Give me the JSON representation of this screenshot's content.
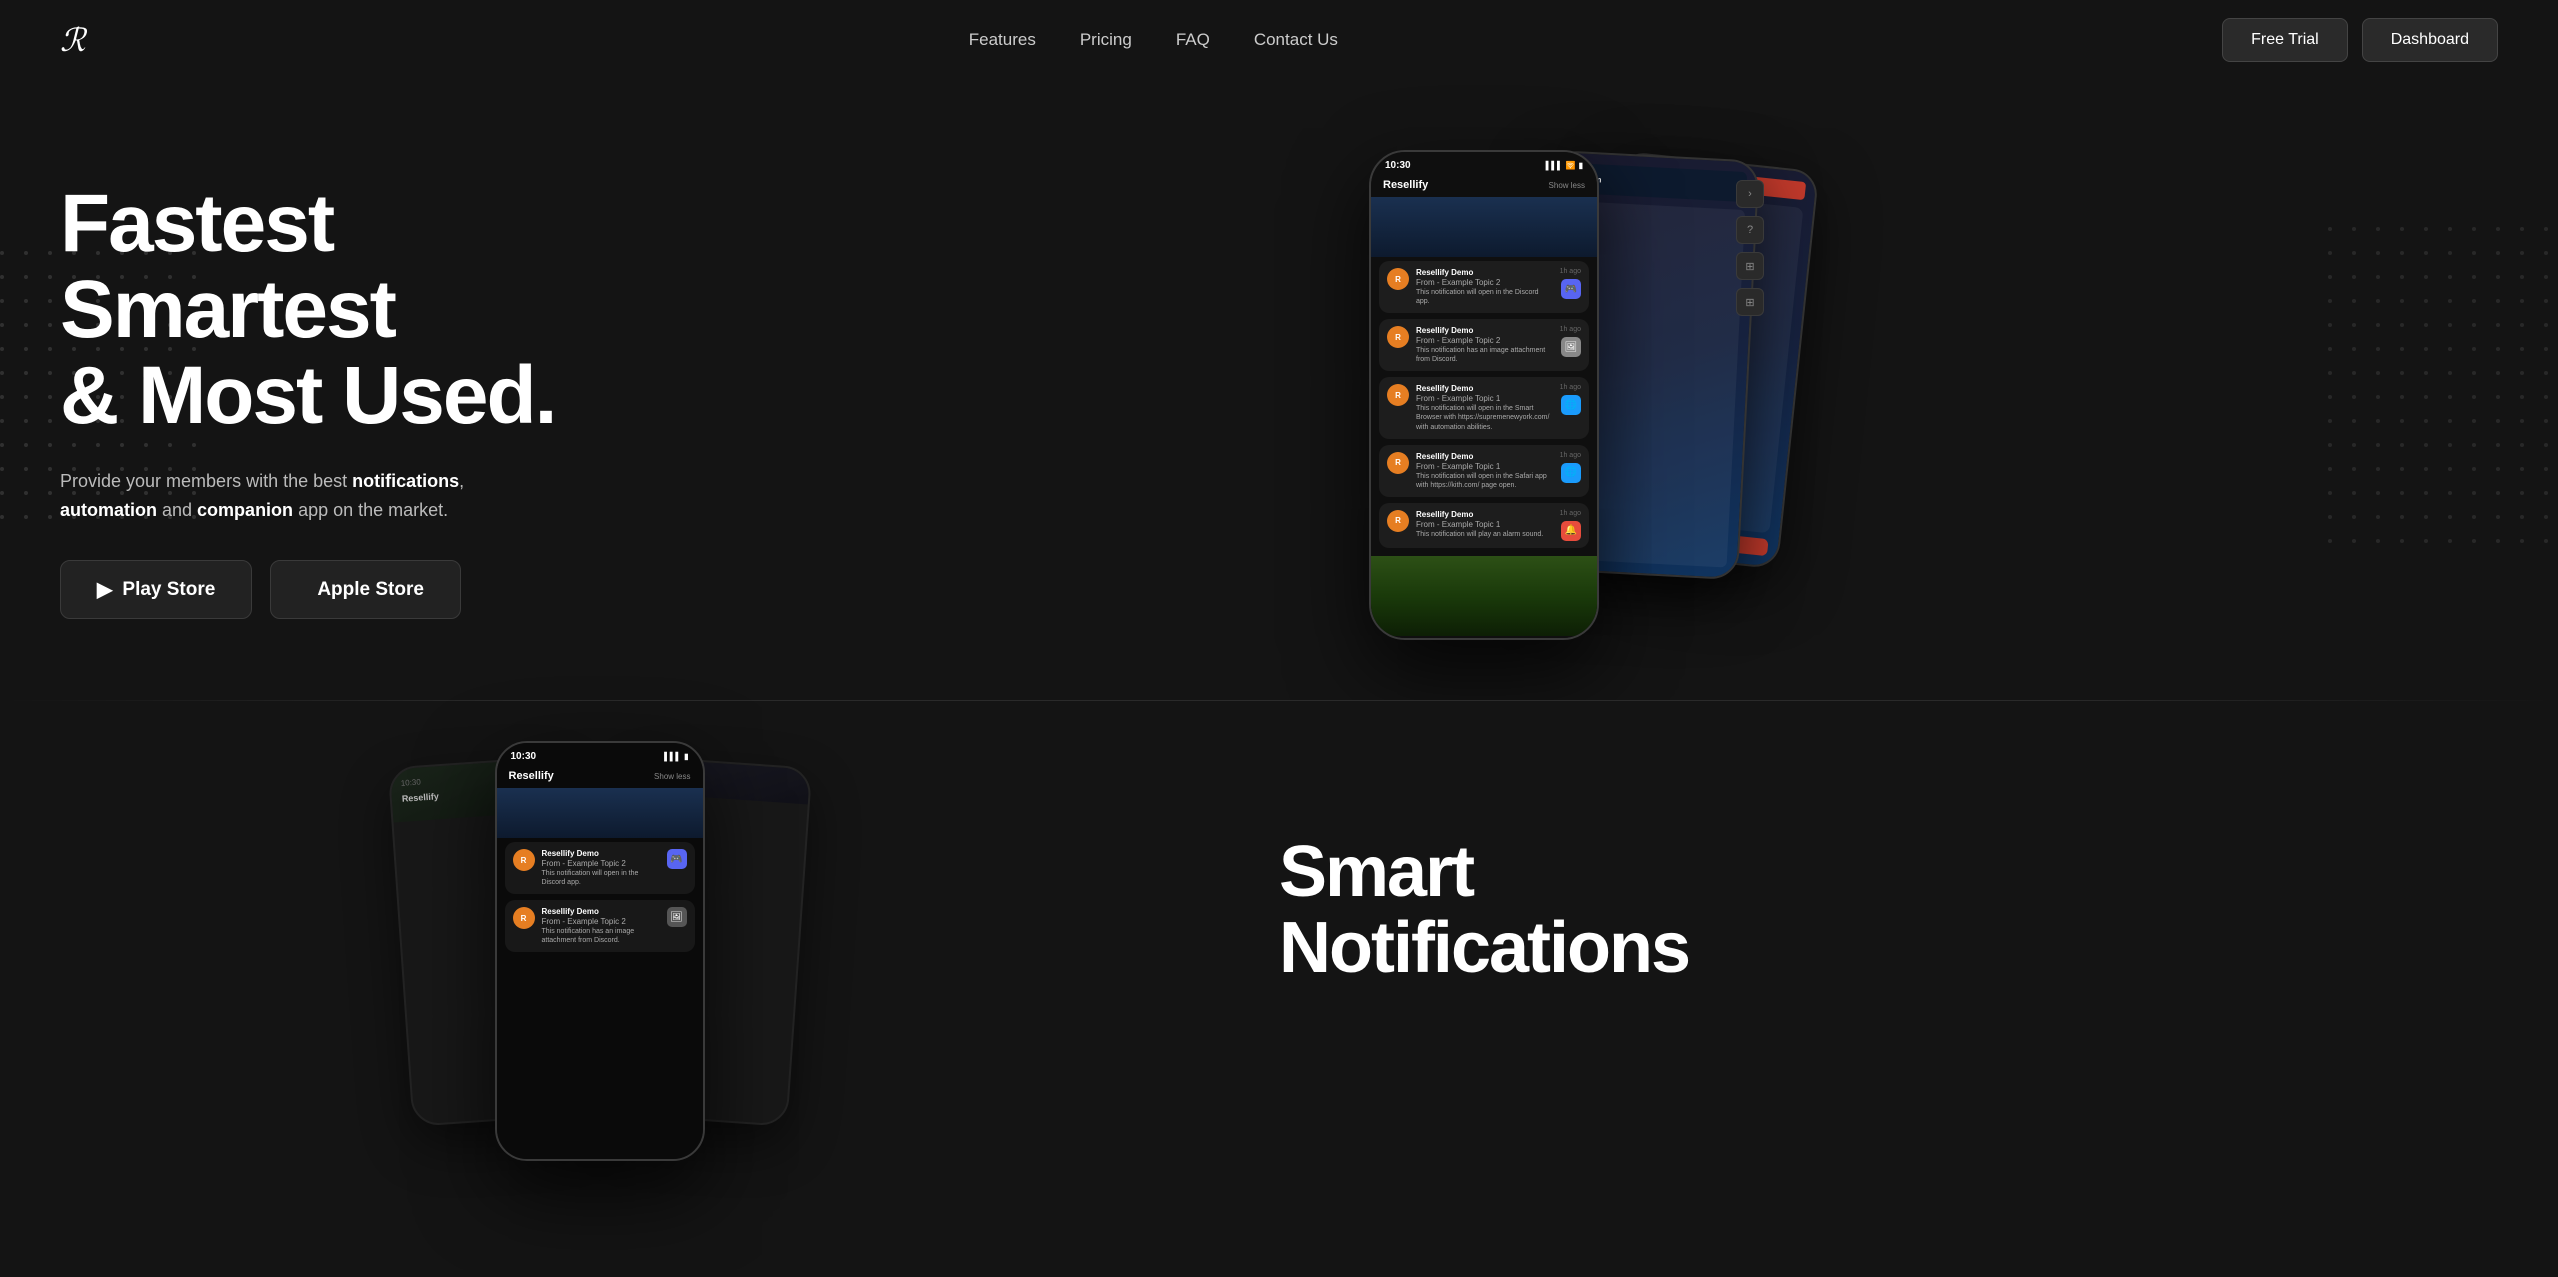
{
  "brand": {
    "logo": "ℛ",
    "name": "Resellify"
  },
  "nav": {
    "links": [
      {
        "id": "features",
        "label": "Features"
      },
      {
        "id": "pricing",
        "label": "Pricing"
      },
      {
        "id": "faq",
        "label": "FAQ"
      },
      {
        "id": "contact",
        "label": "Contact Us"
      }
    ],
    "cta_trial": "Free Trial",
    "cta_dashboard": "Dashboard"
  },
  "hero": {
    "title_line1": "Fastest",
    "title_line2": "Smartest",
    "title_line3": "& Most Used.",
    "desc_plain": "Provide your members with the best ",
    "desc_bold1": "notifications",
    "desc_mid": " and ",
    "desc_bold2": "companion",
    "desc_end": " app on the market.",
    "btn_play": "Play Store",
    "btn_apple": "Apple Store",
    "status_time": "10:30",
    "app_name": "Resellify",
    "notifications": [
      {
        "title": "Resellify Demo",
        "from": "From - Example Topic 2",
        "body": "This notification will open in the Discord app.",
        "time": "1h ago",
        "icon_type": "discord"
      },
      {
        "title": "Resellify Demo",
        "from": "From - Example Topic 2",
        "body": "This notification has an image attachment from Discord.",
        "time": "1h ago",
        "icon_type": "image"
      },
      {
        "title": "Resellify Demo",
        "from": "From - Example Topic 1",
        "body": "This notification will open in the Smart Browser with https://supremenewyork.com/ with automation abilities.",
        "time": "1h ago",
        "icon_type": "safari"
      },
      {
        "title": "Resellify Demo",
        "from": "From - Example Topic 1",
        "body": "This notification will open in the Safari app with https://kith.com/ page open.",
        "time": "1h ago",
        "icon_type": "safari"
      },
      {
        "title": "Resellify Demo",
        "from": "From - Example Topic 1",
        "body": "This notification will play an alarm sound.",
        "time": "1h ago",
        "icon_type": "alarm"
      }
    ]
  },
  "bottom_section": {
    "title_line1": "Smart",
    "title_line2": "Notifications"
  }
}
